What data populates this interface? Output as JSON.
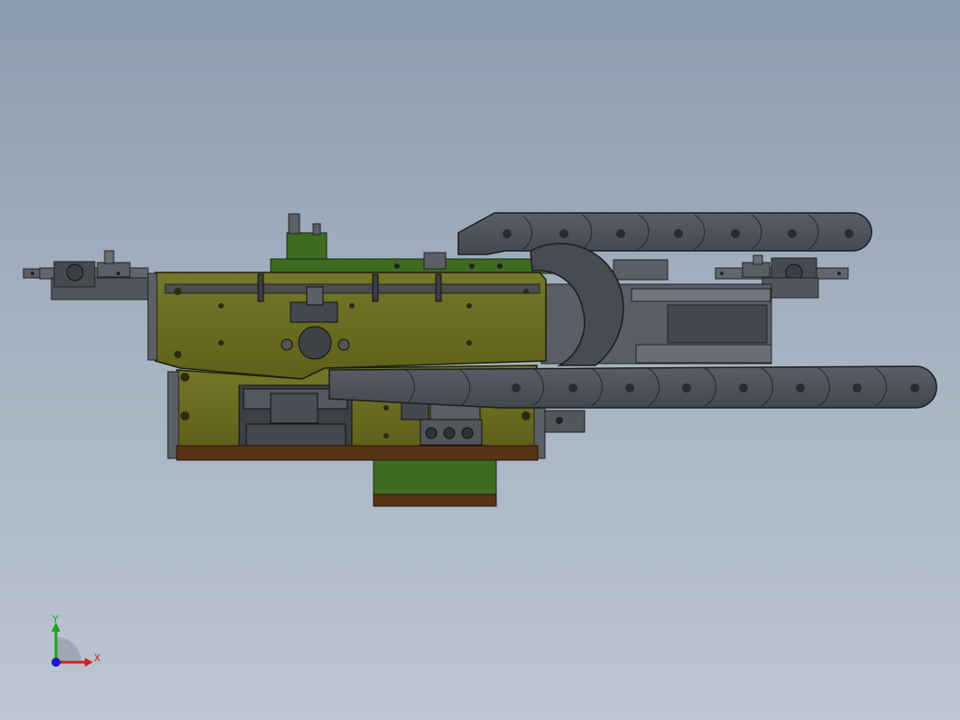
{
  "viewport": {
    "background_top": "#8b9cae",
    "background_bottom": "#bcc6d1"
  },
  "model": {
    "plate_color": "#6b6d1e",
    "green_color": "#3f6b22",
    "chain_color": "#4f535a",
    "dark_color": "#3a3d42",
    "brown_color": "#5a3418"
  },
  "triad": {
    "y_label": "Y",
    "x_label": "X",
    "y_color": "#1aa31a",
    "x_color": "#d42020",
    "z_color": "#1a1acc"
  }
}
